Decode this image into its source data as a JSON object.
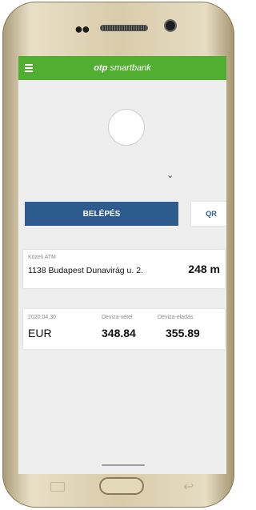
{
  "app": {
    "brand_bold": "otp",
    "brand_rest": "smartbank"
  },
  "login": {
    "button_label": "BELÉPÉS",
    "qr_label": "QR"
  },
  "atm": {
    "label": "Közeli ATM",
    "address": "1138 Budapest Dunavirág u. 2.",
    "distance": "248 m"
  },
  "fx": {
    "date": "2020.04.30",
    "buy_label": "Deviza-vétel",
    "sell_label": "Deviza-eladás",
    "currency": "EUR",
    "buy_value": "348.84",
    "sell_value": "355.89"
  },
  "icons": {
    "menu": "hamburger-icon",
    "chevron": "chevron-down-icon",
    "avatar": "user-avatar",
    "home": "home-button",
    "recent": "recent-apps-icon",
    "back": "back-arrow-icon"
  },
  "colors": {
    "appbar": "#52ae30",
    "primary": "#2d5b8e",
    "background": "#eeeeee"
  }
}
